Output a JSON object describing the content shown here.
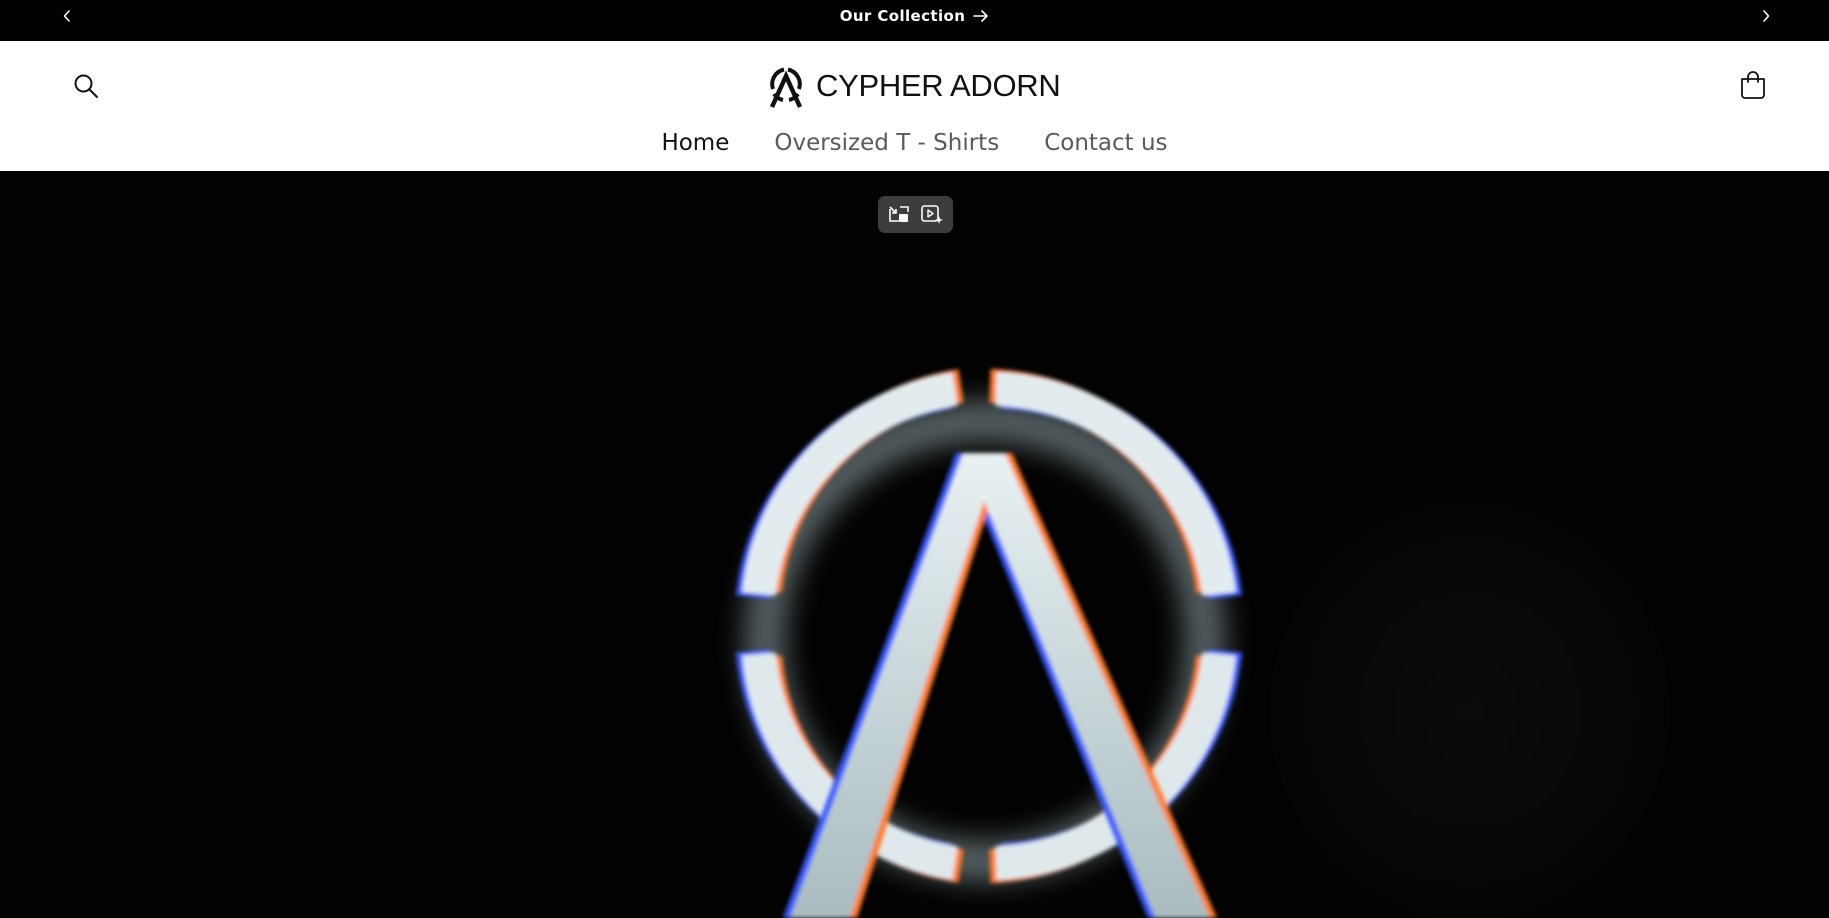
{
  "announcement": {
    "text": "Our Collection",
    "prev_icon": "chevron-left-icon",
    "next_icon": "chevron-right-icon",
    "link_icon": "arrow-right-icon"
  },
  "header": {
    "brand_name": "CYPHER ADORN",
    "search_icon": "search-icon",
    "cart_icon": "cart-icon"
  },
  "nav": {
    "items": [
      {
        "label": "Home",
        "active": true
      },
      {
        "label": "Oversized T - Shirts",
        "active": false
      },
      {
        "label": "Contact us",
        "active": false
      }
    ]
  },
  "media_controls": {
    "exit_pip_icon": "exit-picture-in-picture-icon",
    "video_enhance_icon": "video-sparkle-icon"
  },
  "colors": {
    "announcement_bg": "#000000",
    "header_bg": "#ffffff",
    "hero_bg": "#020202",
    "nav_active": "#121212",
    "nav_inactive": "#5a5a5a"
  }
}
